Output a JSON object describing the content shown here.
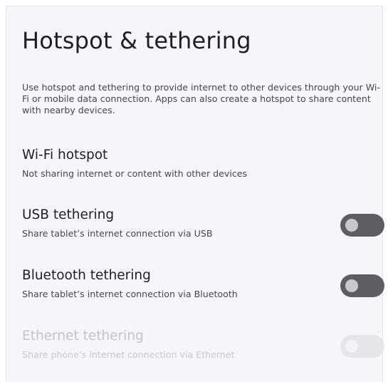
{
  "page": {
    "title": "Hotspot & tethering",
    "intro": "Use hotspot and tethering to provide internet to other devices through your Wi-Fi or mobile data connection. Apps can also create a hotspot to share content with nearby devices."
  },
  "settings": [
    {
      "title": "Wi-Fi hotspot",
      "summary": "Not sharing internet or content with other devices",
      "has_switch": false,
      "enabled": true
    },
    {
      "title": "USB tethering",
      "summary": "Share tablet’s internet connection via USB",
      "has_switch": true,
      "switch_on": false,
      "enabled": true
    },
    {
      "title": "Bluetooth tethering",
      "summary": "Share tablet’s internet connection via Bluetooth",
      "has_switch": true,
      "switch_on": false,
      "enabled": true
    },
    {
      "title": "Ethernet tethering",
      "summary": "Share phone’s internet connection via Ethernet",
      "has_switch": true,
      "switch_on": false,
      "enabled": false
    }
  ],
  "colors": {
    "background": "#f6f5fa",
    "switch_track_off": "#5e5d64",
    "switch_thumb_off": "#c9c7ce",
    "disabled_text": "#c5c4ca"
  }
}
